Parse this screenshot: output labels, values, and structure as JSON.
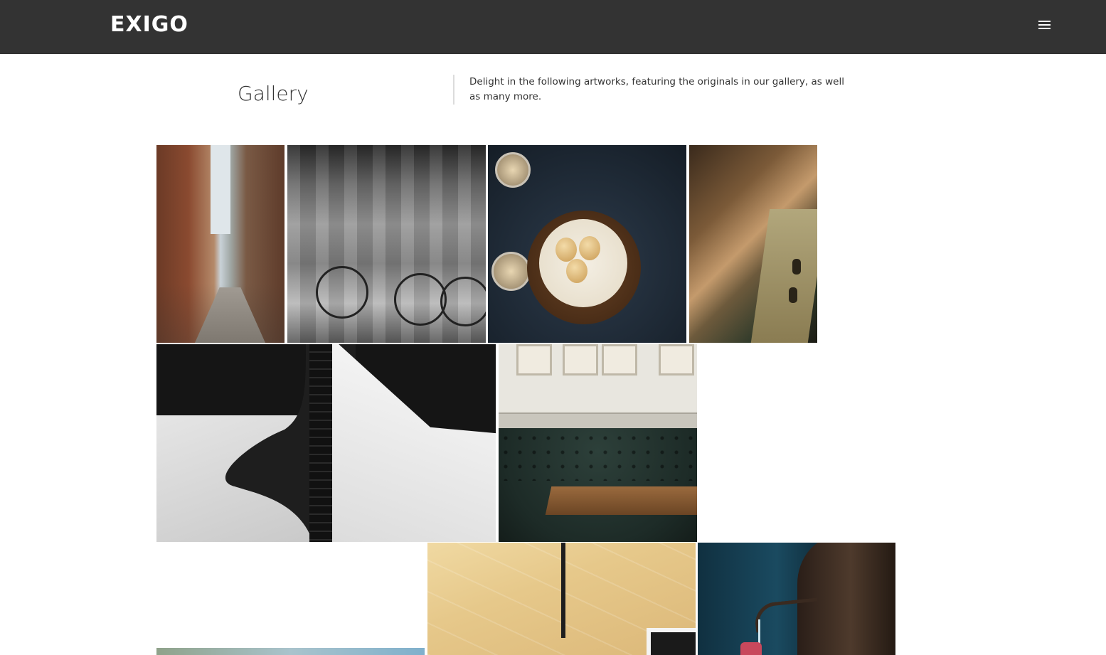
{
  "header": {
    "logo": "EXIGO",
    "menu_icon": "hamburger-menu-icon",
    "background": "#333333"
  },
  "main": {
    "title": "Gallery",
    "intro": "Delight in the following artworks, featuring the originals in our gallery, as well as many more."
  },
  "gallery": {
    "items": [
      {
        "subject": "city-alley-photo"
      },
      {
        "subject": "cyclists-motion-blur-photo"
      },
      {
        "subject": "dessert-cake-photo"
      },
      {
        "subject": "man-with-radio-photo"
      },
      {
        "subject": "black-white-architecture-photo"
      },
      {
        "subject": "cafe-leather-booth-photo"
      },
      {
        "subject": "yellow-wall-pipe-photo"
      },
      {
        "subject": "pouring-kettle-photo"
      },
      {
        "subject": "landscape-photo"
      }
    ]
  }
}
